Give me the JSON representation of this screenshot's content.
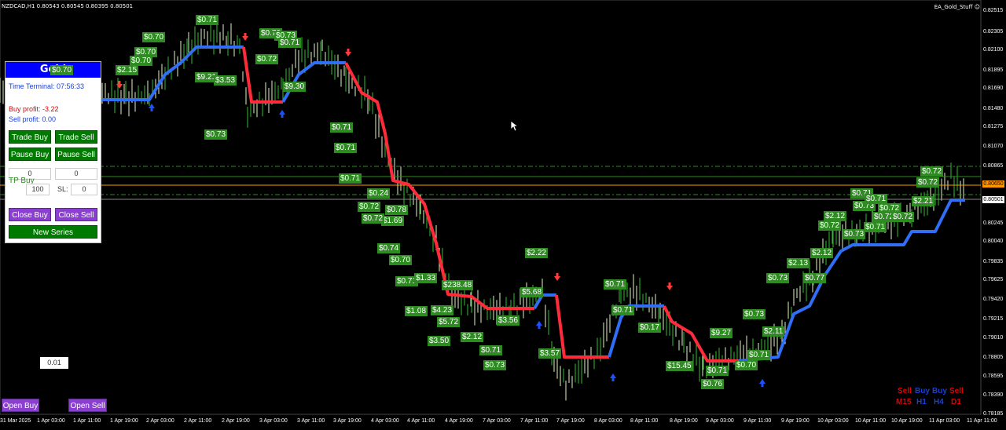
{
  "header": {
    "symbol_info": "NZDCAD,H1  0.80543 0.80545 0.80395 0.80501",
    "ea_name": "EA_Gold_Stuff"
  },
  "panel": {
    "title": "Gold",
    "title_tag": "$0.70",
    "terminal_time": "Time Terminal: 07:56:33",
    "buy_profit": "Buy profit: -3.22",
    "sell_profit": "Sell profit: 0.00",
    "trade_buy": "Trade Buy",
    "trade_sell": "Trade Sell",
    "pause_buy": "Pause Buy",
    "pause_sell": "Pause Sell",
    "input_left": "0",
    "input_right": "0",
    "tp_buy": "TP Buy",
    "tp_value": "100",
    "sl_label": "SL:",
    "sl_value": "0",
    "close_buy": "Close Buy",
    "close_sell": "Close Sell",
    "new_series": "New Series"
  },
  "bottom": {
    "lot": "0.01",
    "open_buy": "Open Buy",
    "open_sell": "Open Sell"
  },
  "colors": {
    "up_line": "#2f6ef5",
    "down_line": "#ff2b3a",
    "tag_bg": "#2e8b22",
    "button_green": "#007a00",
    "button_purple": "#8a3fd1"
  },
  "icons": [
    "buy-arrow-icon",
    "sell-arrow-icon",
    "cursor-icon",
    "settings-icon"
  ],
  "chart_data": {
    "type": "candlestick",
    "yaxis": {
      "ticks": [
        "0.82515",
        "0.82305",
        "0.82100",
        "0.81895",
        "0.81690",
        "0.81480",
        "0.81275",
        "0.81070",
        "0.80865",
        "0.80650",
        "0.80501",
        "0.80245",
        "0.80040",
        "0.79835",
        "0.79625",
        "0.79420",
        "0.79215",
        "0.79010",
        "0.78805",
        "0.78595",
        "0.78390",
        "0.78185"
      ],
      "price_current": "0.80501",
      "price_orange": "0.80650"
    },
    "xaxis": {
      "ticks": [
        "31 Mar 2025",
        "1 Apr 03:00",
        "1 Apr 11:00",
        "1 Apr 19:00",
        "2 Apr 03:00",
        "2 Apr 11:00",
        "2 Apr 19:00",
        "3 Apr 03:00",
        "3 Apr 11:00",
        "3 Apr 19:00",
        "4 Apr 03:00",
        "4 Apr 11:00",
        "4 Apr 19:00",
        "7 Apr 03:00",
        "7 Apr 11:00",
        "7 Apr 19:00",
        "8 Apr 03:00",
        "8 Apr 11:00",
        "8 Apr 19:00",
        "9 Apr 03:00",
        "9 Apr 11:00",
        "9 Apr 19:00",
        "10 Apr 03:00",
        "10 Apr 11:00",
        "10 Apr 19:00",
        "11 Apr 03:00",
        "11 Apr 11:00"
      ]
    },
    "tags": [
      "$0.71",
      "$0.70",
      "$0.70",
      "$0.70",
      "$2.15",
      "$9.21",
      "$3.53",
      "$0.72",
      "$0.73",
      "$0.73",
      "$0.71",
      "$9.30",
      "$0.71",
      "$0.73",
      "$0.71",
      "$0.71",
      "$0.24",
      "$0.72",
      "$0.78",
      "$1.69",
      "$0.72",
      "$0.74",
      "$0.70",
      "$0.71",
      "$1.33",
      "$238.48",
      "$4.23",
      "$1.08",
      "$5.72",
      "$3.50",
      "$2.12",
      "$0.71",
      "$0.73",
      "$3.56",
      "$5.68",
      "$2.22",
      "$3.57",
      "$0.71",
      "$0.71",
      "$0.17",
      "$15.45",
      "$0.73",
      "$9.27",
      "$0.71",
      "$0.76",
      "$0.70",
      "$0.71",
      "$2.11",
      "$2.13",
      "$0.73",
      "$0.77",
      "$2.12",
      "$2.12",
      "$0.72",
      "$0.73",
      "$0.71",
      "$0.73",
      "$0.71",
      "$0.72",
      "$0.72",
      "$0.72",
      "$0.71",
      "$2.21",
      "$0.72",
      "$0.72"
    ],
    "legend": {
      "labels_top": [
        "Sell",
        "Buy",
        "Buy",
        "Sell"
      ],
      "labels_bottom": [
        "M15",
        "H1",
        "H4",
        "D1"
      ]
    }
  }
}
